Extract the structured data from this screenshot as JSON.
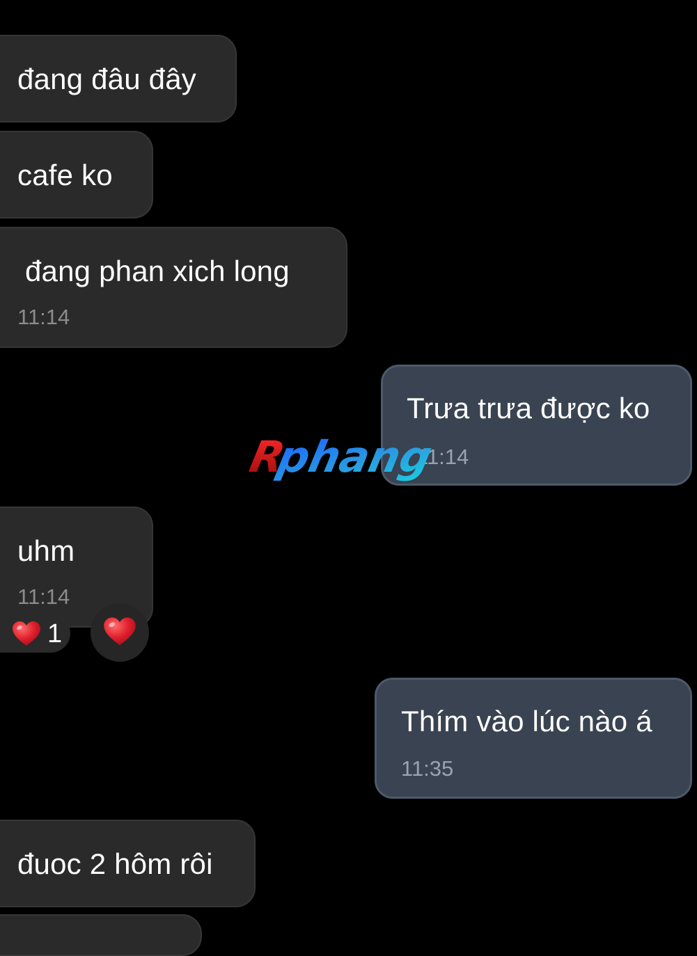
{
  "messages": [
    {
      "text": "đang đâu đây"
    },
    {
      "text": "cafe ko"
    },
    {
      "text": "đang phan xich long",
      "time": "11:14"
    },
    {
      "text": "Trưa trưa được ko",
      "time": "11:14"
    },
    {
      "text": "uhm",
      "time": "11:14"
    },
    {
      "text": "Thím vào lúc nào á",
      "time": "11:35"
    },
    {
      "text": "đuoc 2 hôm rôi"
    }
  ],
  "reaction": {
    "emoji": "heart-icon",
    "count": "1"
  },
  "react_button": {
    "emoji": "heart-icon"
  },
  "watermark": {
    "text": "Rphang"
  },
  "colors": {
    "background": "#000000",
    "incoming_bubble": "#2a2a2a",
    "outgoing_bubble": "#3a4351",
    "outgoing_border": "#4d5a6b",
    "timestamp": "#8c8c8c",
    "heart": "#e0212e"
  }
}
